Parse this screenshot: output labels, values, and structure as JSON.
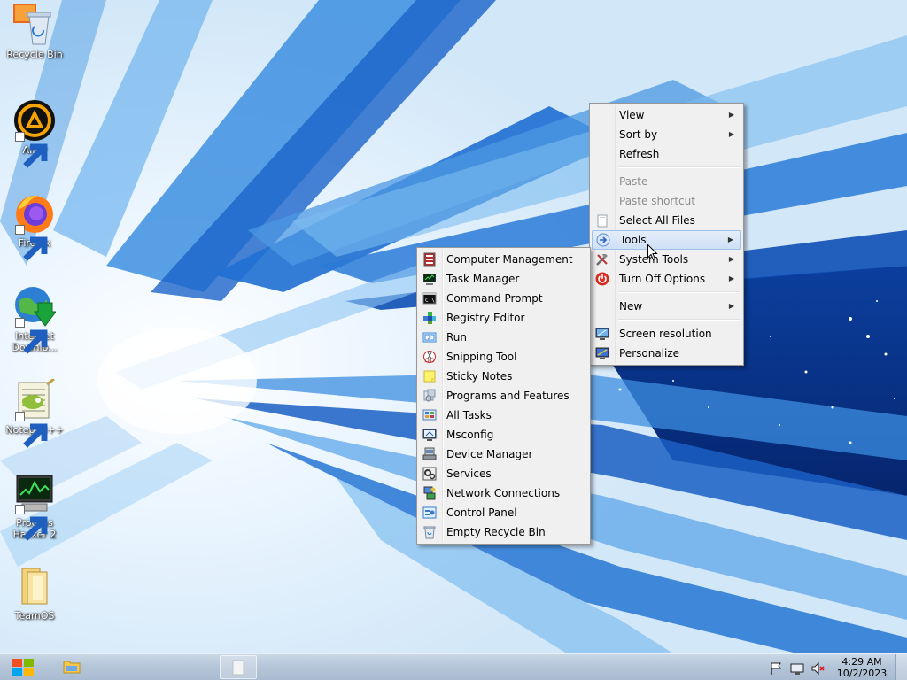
{
  "desktop_icons": [
    {
      "label": "Recycle Bin",
      "icon": "recycle-bin-icon"
    },
    {
      "label": "AIMP",
      "icon": "aimp-icon"
    },
    {
      "label": "Firefox",
      "icon": "firefox-icon"
    },
    {
      "label": "Internet Downlo...",
      "icon": "internet-download-manager-icon"
    },
    {
      "label": "Notepad++",
      "icon": "notepad-plus-plus-icon"
    },
    {
      "label": "Process Hacker 2",
      "icon": "process-hacker-icon"
    },
    {
      "label": "TeamOS",
      "icon": "folder-icon"
    }
  ],
  "context_menu": {
    "items": [
      {
        "label": "View",
        "has_submenu": true
      },
      {
        "label": "Sort by",
        "has_submenu": true
      },
      {
        "label": "Refresh"
      },
      {
        "label": "Paste",
        "disabled": true
      },
      {
        "label": "Paste shortcut",
        "disabled": true
      },
      {
        "label": "Select All Files",
        "icon": "select-all-icon"
      },
      {
        "label": "Tools",
        "icon": "arrow-right-icon",
        "has_submenu": true,
        "highlighted": true
      },
      {
        "label": "System Tools",
        "icon": "wrench-hammer-icon",
        "has_submenu": true
      },
      {
        "label": "Turn Off Options",
        "icon": "power-icon",
        "has_submenu": true
      },
      {
        "label": "New",
        "has_submenu": true
      },
      {
        "label": "Screen resolution",
        "icon": "screen-resolution-icon"
      },
      {
        "label": "Personalize",
        "icon": "personalize-icon"
      }
    ]
  },
  "tools_submenu": {
    "items": [
      {
        "label": "Computer Management",
        "icon": "computer-management-icon"
      },
      {
        "label": "Task Manager",
        "icon": "task-manager-icon"
      },
      {
        "label": "Command Prompt",
        "icon": "command-prompt-icon"
      },
      {
        "label": "Registry Editor",
        "icon": "registry-editor-icon"
      },
      {
        "label": "Run",
        "icon": "run-icon"
      },
      {
        "label": "Snipping Tool",
        "icon": "snipping-tool-icon"
      },
      {
        "label": "Sticky Notes",
        "icon": "sticky-notes-icon"
      },
      {
        "label": "Programs and Features",
        "icon": "programs-features-icon"
      },
      {
        "label": "All Tasks",
        "icon": "all-tasks-icon"
      },
      {
        "label": "Msconfig",
        "icon": "msconfig-icon"
      },
      {
        "label": "Device Manager",
        "icon": "device-manager-icon"
      },
      {
        "label": "Services",
        "icon": "services-icon"
      },
      {
        "label": "Network Connections",
        "icon": "network-connections-icon"
      },
      {
        "label": "Control Panel",
        "icon": "control-panel-icon"
      },
      {
        "label": "Empty Recycle Bin",
        "icon": "empty-recycle-bin-icon"
      }
    ]
  },
  "taskbar": {
    "start_icon": "windows-logo-icon",
    "pinned": [
      {
        "icon": "file-explorer-icon"
      }
    ],
    "tray": {
      "icons": [
        "action-center-flag-icon",
        "network-icon",
        "volume-muted-icon"
      ]
    },
    "clock": {
      "time": "4:29 AM",
      "date": "10/2/2023"
    }
  },
  "colors": {
    "menu_background": "#f0f0f0",
    "menu_highlight": "#cfe0f6",
    "taskbar": "#b6c6d9",
    "wallpaper_blue": "#1e6fc8"
  }
}
